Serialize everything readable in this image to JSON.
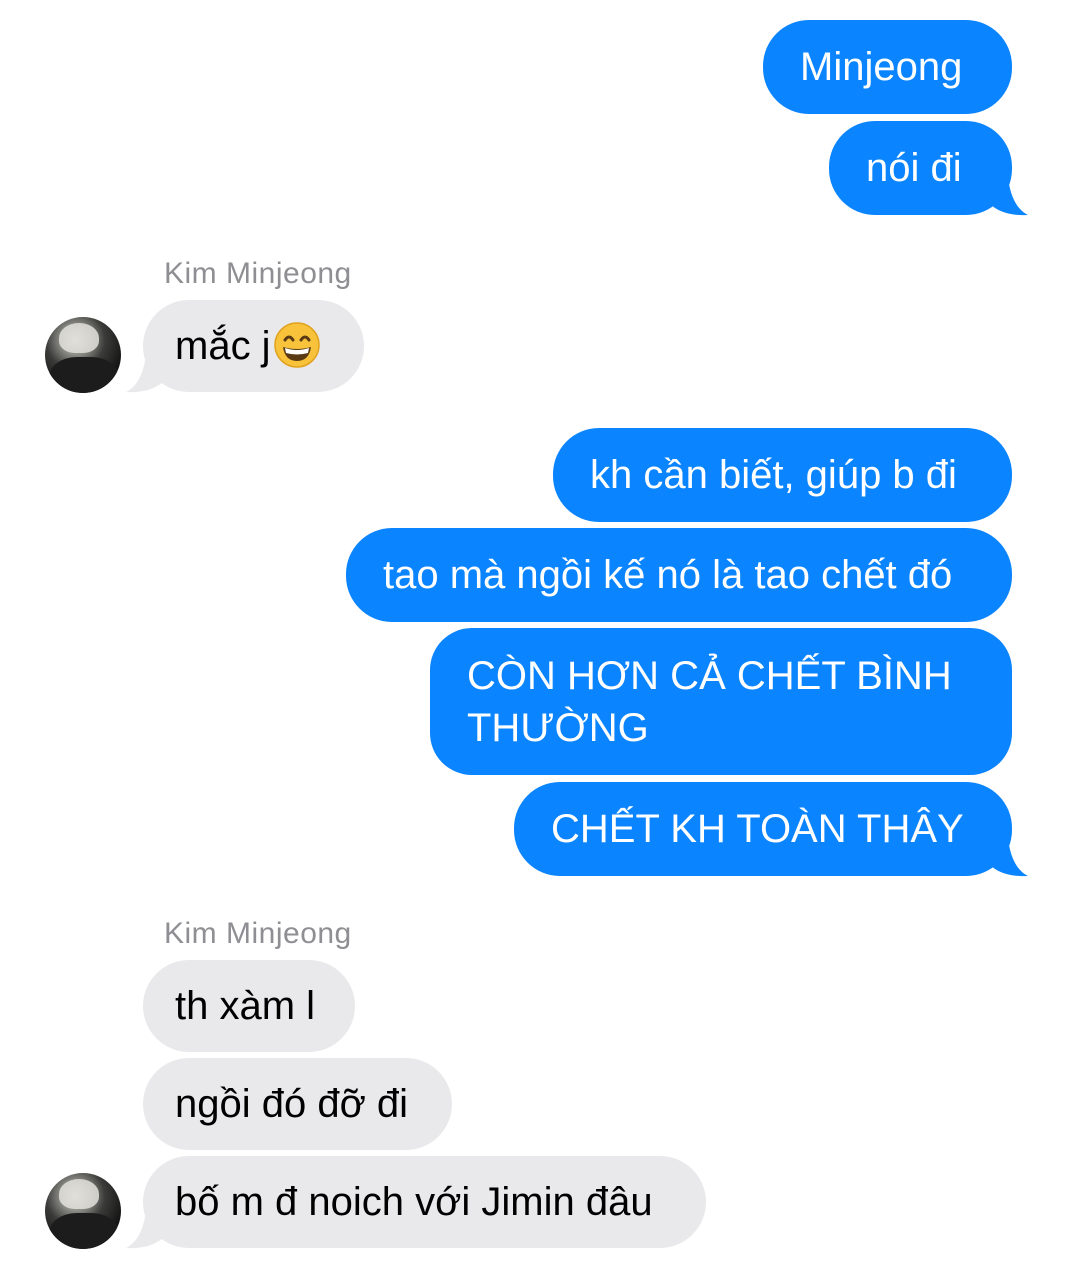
{
  "conversation": {
    "contact_name": "Kim Minjeong",
    "sent_color": "#0a84ff",
    "received_color": "#e9e9eb",
    "sender_label_color": "#8e8e93"
  },
  "messages": {
    "m1": "Minjeong",
    "m2": "nói đi",
    "m3_sender": "Kim Minjeong",
    "m3": "mắc j",
    "m3_emoji": "grinning-face-with-smiling-eyes",
    "m4": "kh cần biết, giúp b đi",
    "m5": "tao mà ngồi kế nó là tao chết đó",
    "m6": "CÒN HƠN CẢ CHẾT BÌNH THƯỜNG",
    "m7": "CHẾT KH TOÀN THÂY",
    "m8_sender": "Kim Minjeong",
    "m8": "th xàm l",
    "m9": "ngồi đó đỡ đi",
    "m10": "bố m đ noich với Jimin đâu"
  }
}
